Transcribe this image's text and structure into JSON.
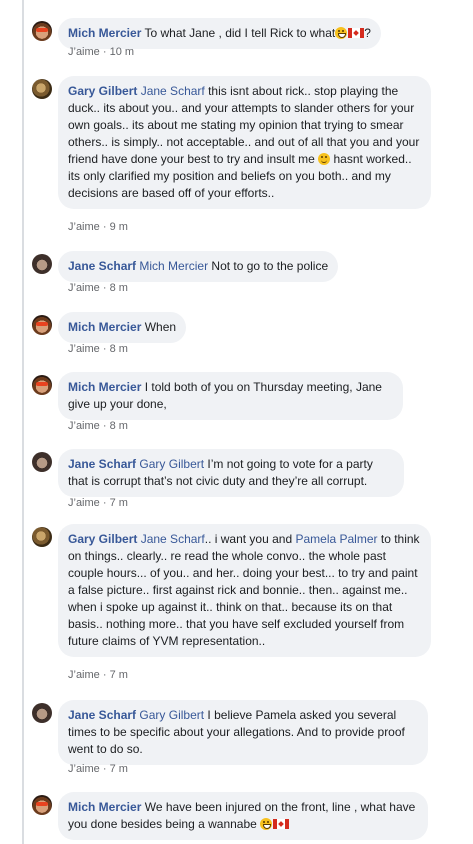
{
  "like_label": "J’aime",
  "comments": [
    {
      "author": "Mich Mercier",
      "mention": "",
      "text_before": "To what Jane , did I tell Rick to what",
      "text_after": "?",
      "time": "10 m",
      "avatar": "mich"
    },
    {
      "author": "Gary Gilbert",
      "mention": "Jane Scharf",
      "text_before": "this isnt about rick.. stop playing the duck.. its about you.. and your attempts to slander others for your own goals.. its about me stating my opinion that trying to smear others.. is simply.. not acceptable.. and out of all that you and your friend have done your best to try and insult me",
      "text_after": "hasnt worked.. its only clarified my position and beliefs on you both.. and my decisions are based off of your efforts..",
      "time": "9 m",
      "avatar": "gary"
    },
    {
      "author": "Jane Scharf",
      "mention": "Mich Mercier",
      "text_before": "Not to go to the police",
      "text_after": "",
      "time": "8 m",
      "avatar": "jane"
    },
    {
      "author": "Mich Mercier",
      "mention": "",
      "text_before": "When",
      "text_after": "",
      "time": "8 m",
      "avatar": "mich"
    },
    {
      "author": "Mich Mercier",
      "mention": "",
      "text_before": "I told both of you on Thursday meeting, Jane give up your done,",
      "text_after": "",
      "time": "8 m",
      "avatar": "mich"
    },
    {
      "author": "Jane Scharf",
      "mention": "Gary Gilbert",
      "text_before": "I’m not going to vote for a party that is corrupt that’s not civic duty and they’re all corrupt.",
      "text_after": "",
      "time": "7 m",
      "avatar": "jane"
    },
    {
      "author": "Gary Gilbert",
      "mention": "Jane Scharf",
      "text_before": ".. i want you and",
      "mention2": "Pamela Palmer",
      "text_after": "to think on things.. clearly.. re read the whole convo.. the whole past couple hours... of you.. and her.. doing your best... to try and paint a false picture.. first against rick and bonnie.. then.. against me.. when i spoke up against it.. think on that.. because its on that basis.. nothing more.. that you have self excluded yourself from future claims of YVM representation..",
      "time": "7 m",
      "avatar": "gary"
    },
    {
      "author": "Jane Scharf",
      "mention": "Gary Gilbert",
      "text_before": "I believe Pamela asked you several times to be specific about your allegations. And to provide proof went to do so.",
      "text_after": "",
      "time": "7 m",
      "avatar": "jane"
    },
    {
      "author": "Mich Mercier",
      "mention": "",
      "text_before": "We have been injured on the front, line , what have you done besides being a wannabe",
      "text_after": "",
      "time": "",
      "avatar": "mich"
    }
  ]
}
